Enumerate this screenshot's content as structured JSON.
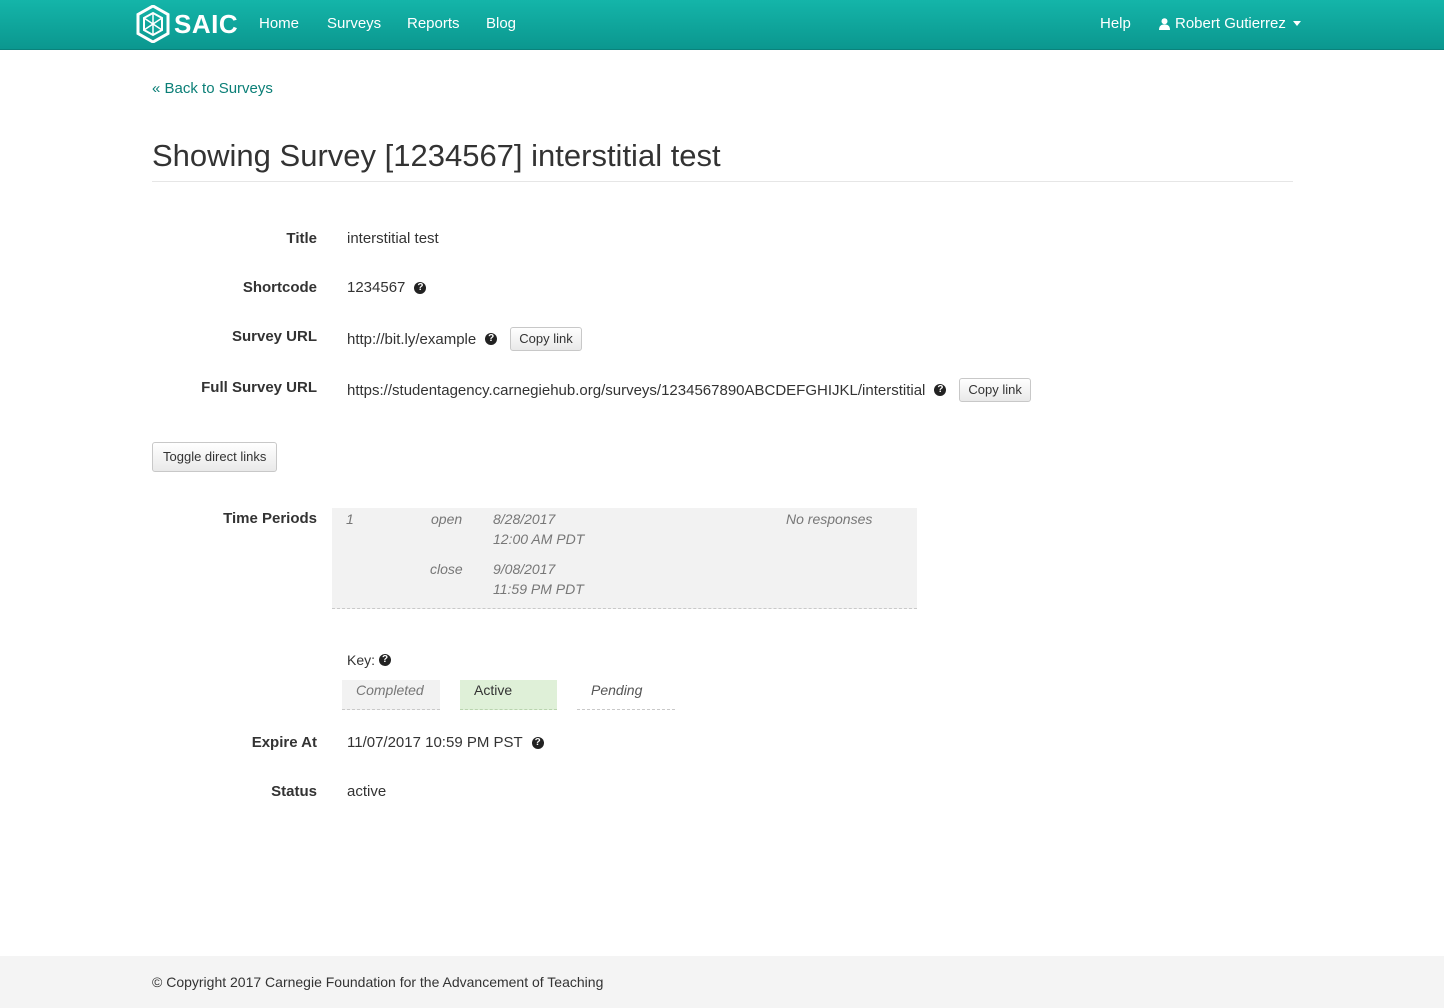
{
  "navbar": {
    "brand": "SAIC",
    "links": [
      "Home",
      "Surveys",
      "Reports",
      "Blog"
    ],
    "help": "Help",
    "user": "Robert Gutierrez"
  },
  "back_link": "« Back to Surveys",
  "page_title": "Showing Survey [1234567] interstitial test",
  "fields": {
    "title_label": "Title",
    "title_value": "interstitial test",
    "shortcode_label": "Shortcode",
    "shortcode_value": "1234567",
    "survey_url_label": "Survey URL",
    "survey_url_value": "http://bit.ly/example",
    "full_url_label": "Full Survey URL",
    "full_url_value": "https://studentagency.carnegiehub.org/surveys/1234567890ABCDEFGHIJKL/interstitial",
    "copy_link": "Copy link",
    "toggle_button": "Toggle direct links",
    "time_periods_label": "Time Periods",
    "expire_label": "Expire At",
    "expire_value": "11/07/2017 10:59 PM PST",
    "status_label": "Status",
    "status_value": "active"
  },
  "time_periods": [
    {
      "number": "1",
      "open_label": "open",
      "open_date": "8/28/2017",
      "open_time": "12:00 AM PDT",
      "close_label": "close",
      "close_date": "9/08/2017",
      "close_time": "11:59 PM PDT",
      "responses": "No responses"
    }
  ],
  "key": {
    "label": "Key:",
    "completed": "Completed",
    "active": "Active",
    "pending": "Pending"
  },
  "footer": "© Copyright 2017 Carnegie Foundation for the Advancement of Teaching",
  "colors": {
    "navbar_top": "#14b5a9",
    "navbar_bottom": "#0b978f",
    "link": "#0b7f77",
    "active_bg": "#dff0d8",
    "completed_bg": "#f2f2f2"
  }
}
